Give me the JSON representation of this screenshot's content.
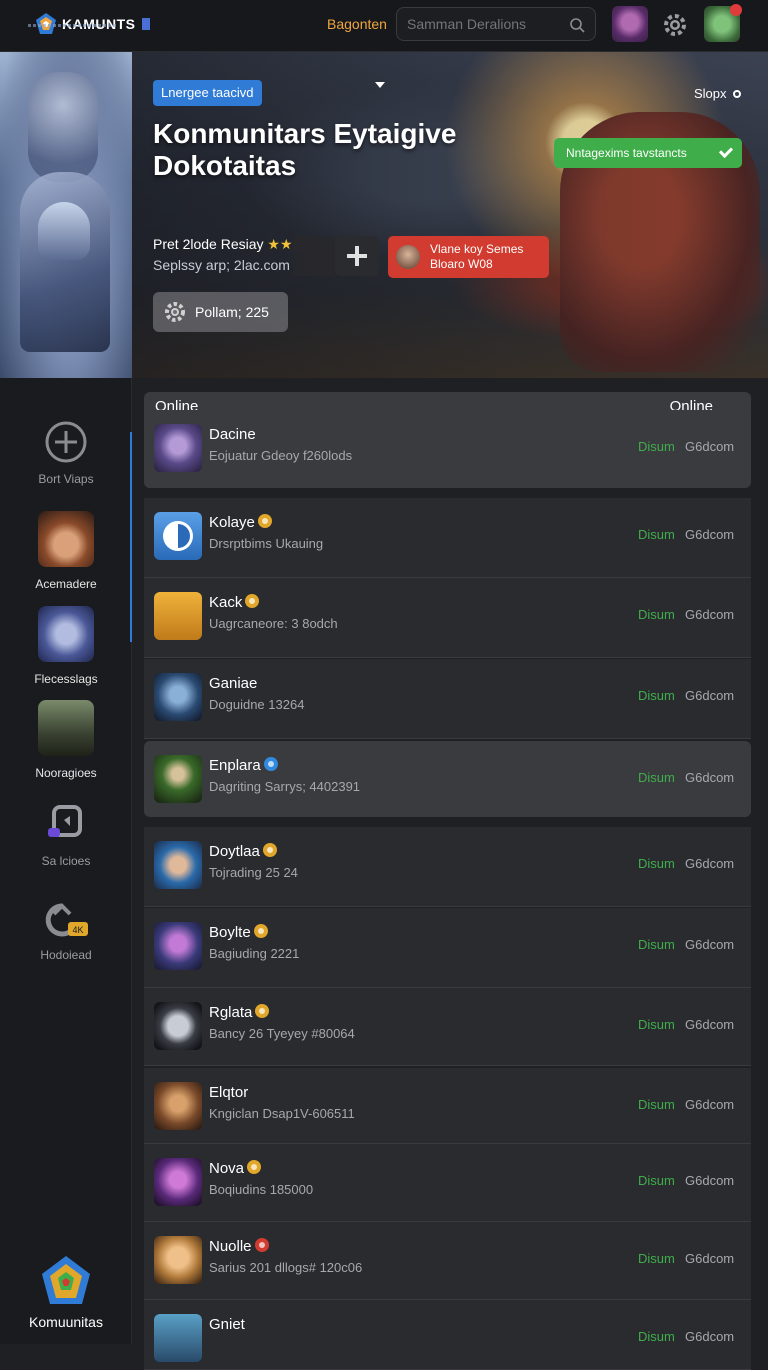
{
  "topbar": {
    "logo_text": "KAMUNTS",
    "nav_link": "Bagonten",
    "search_placeholder": "Samman Deralions"
  },
  "hero": {
    "pill": "Lnergee taacivd",
    "corner_link": "Slopx",
    "title_line1": "Konmunitars Eytaigive",
    "title_line2": "Dokotaitas",
    "cta": "Nntagexims  tavstancts",
    "meta_title": "Pret 2lode Resiay",
    "meta_sub": "Seplssy arp; 2lac.com",
    "card_line1": "Vlane koy Semes",
    "card_line2": "Bloaro W08",
    "poll_label": "Pollam; 225"
  },
  "sidebar": {
    "items": [
      {
        "label": "Bort Viaps"
      },
      {
        "label": "Acemadere"
      },
      {
        "label": "Flecesslags"
      },
      {
        "label": "Nooragioes"
      },
      {
        "label": "Sa lcioes"
      },
      {
        "label": "Hodoiead"
      }
    ],
    "brand": "Komuunitas"
  },
  "list": {
    "header_left": "Online",
    "header_right": "Online",
    "rows": [
      {
        "name": "Dacine",
        "sub": "Eojuatur Gdeoy f260lods",
        "status": "Disum",
        "domain": "G6dcom",
        "badge": ""
      },
      {
        "name": "Kolaye",
        "sub": "Drsrptbims Ukauing",
        "status": "Disum",
        "domain": "G6dcom",
        "badge": "gold"
      },
      {
        "name": "Kack",
        "sub": "Uagrcaneore: 3 8odch",
        "status": "Disum",
        "domain": "G6dcom",
        "badge": "gold"
      },
      {
        "name": "Ganiae",
        "sub": "Doguidne 13264",
        "status": "Disum",
        "domain": "G6dcom",
        "badge": ""
      },
      {
        "name": "Enplara",
        "sub": "Dagriting Sarrys; 4402391",
        "status": "Disum",
        "domain": "G6dcom",
        "badge": "blue"
      },
      {
        "name": "Doytlaa",
        "sub": "Tojrading 25 24",
        "status": "Disum",
        "domain": "G6dcom",
        "badge": "gold"
      },
      {
        "name": "Boylte",
        "sub": "Bagiuding 2221",
        "status": "Disum",
        "domain": "G6dcom",
        "badge": "gold"
      },
      {
        "name": "Rglata",
        "sub": "Bancy 26 Tyeyey #80064",
        "status": "Disum",
        "domain": "G6dcom",
        "badge": "gold"
      },
      {
        "name": "Elqtor",
        "sub": "Kngiclan Dsap1V-606511",
        "status": "Disum",
        "domain": "G6dcom",
        "badge": ""
      },
      {
        "name": "Nova",
        "sub": "Boqiudins 185000",
        "status": "Disum",
        "domain": "G6dcom",
        "badge": "gold"
      },
      {
        "name": "Nuolle",
        "sub": "Sarius 201 dllogs# 120c06",
        "status": "Disum",
        "domain": "G6dcom",
        "badge": "red"
      },
      {
        "name": "Gniet",
        "sub": "",
        "status": "Disum",
        "domain": "G6dcom",
        "badge": ""
      }
    ]
  },
  "colors": {
    "accent_orange": "#f0a640",
    "accent_blue": "#2f7bd6",
    "accent_green": "#3fae4a",
    "accent_red": "#d23b2f",
    "background": "#1f2023"
  }
}
